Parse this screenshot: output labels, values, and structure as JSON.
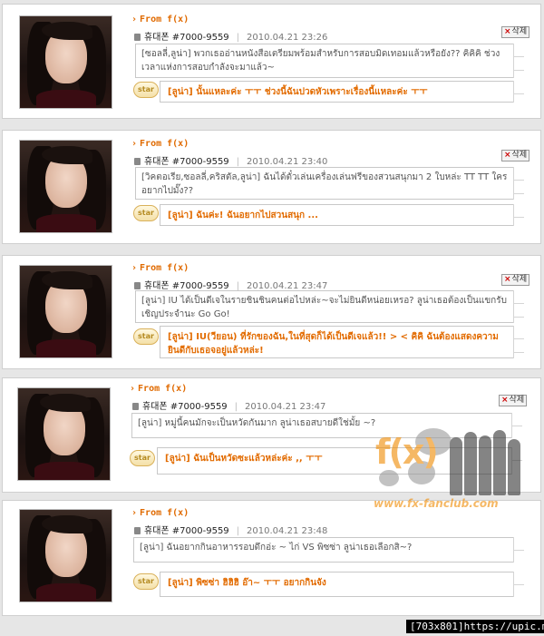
{
  "posts": [
    {
      "from": "From f(x)",
      "user": "휴대폰 #7000-9559",
      "date": "2010.04.21 23:26",
      "delete_label": "삭제",
      "message": "[ซอลลี่,ลูน่า] พวกเธออ่านหนังสือเตรียมพร้อมสำหรับการสอบมิดเทอมแล้วหรือยัง?? คิคิคิ ช่วงเวลาแห่งการสอบกำลังจะมาแล้ว~",
      "star_label": "star",
      "reply": "[ลูน่า] นั้นแหละค่ะ ㅜㅜ ช่วงนี้ฉันปวดหัวเพราะเรื่องนี้แหละค่ะ ㅜㅜ"
    },
    {
      "from": "From f(x)",
      "user": "휴대폰 #7000-9559",
      "date": "2010.04.21 23:40",
      "delete_label": "삭제",
      "message": "[วิคตอเรีย,ซอลลี่,คริสตัล,ลูน่า] ฉันได้ตั๋วเล่นเครื่องเล่นฟรีของสวนสนุกมา 2 ใบหล่ะ TT TT ใครอยากไปมั๊ง??",
      "star_label": "star",
      "reply": "[ลูน่า] ฉันค่ะ! ฉันอยากไปสวนสนุก ..."
    },
    {
      "from": "From f(x)",
      "user": "휴대폰 #7000-9559",
      "date": "2010.04.21 23:47",
      "delete_label": "삭제",
      "message": "[ลูน่า] IU ได้เป็นดีเจในรายชินชินคนต่อไปหล่ะ~จะไม่ยินดีหน่อยเหรอ? ลูน่าเธอต้องเป็นแขกรับเชิญประจำนะ Go Go!",
      "star_label": "star",
      "reply": "[ลูน่า] IU(วียอน) ที่รักของฉัน,ในที่สุดก็ได้เป็นดีเจแล้ว!! > < คิคิ ฉันต้องแสดงความยินดีกับเธอจอยู่แล้วหล่ะ!"
    },
    {
      "from": "From f(x)",
      "user": "휴대폰 #7000-9559",
      "date": "2010.04.21 23:47",
      "delete_label": "삭제",
      "message": "[ลูน่า] หมู่นี้คนมักจะเป็นหวัดกันมาก ลูน่าเธอสบายดีใช่มั้ย ~?",
      "star_label": "star",
      "reply": "[ลูน่า] ฉันเป็นหวัดซะแล้วหล่ะค่ะ ,, ㅜㅜ"
    },
    {
      "from": "From f(x)",
      "user": "휴대폰 #7000-9559",
      "date": "2010.04.21 23:48",
      "delete_label": "삭제",
      "message": "[ลูน่า] ฉันอยากกินอาหารรอบดึกอ่ะ ~ ไก่ VS พิซซ่า ลูน่าเธอเลือกสิ~?",
      "star_label": "star",
      "reply": "[ลูน่า] พิซซ่า ฮิฮิฮิ อ๊า~ ㅜㅜ อยากกินจัง"
    }
  ],
  "watermark": {
    "logo": "f(x)",
    "url": "www.fx-fanclub.com"
  },
  "footer": "[703x801]https://upic.me/",
  "colors": {
    "accent": "#e06a00",
    "reply_text": "#e26b00"
  }
}
